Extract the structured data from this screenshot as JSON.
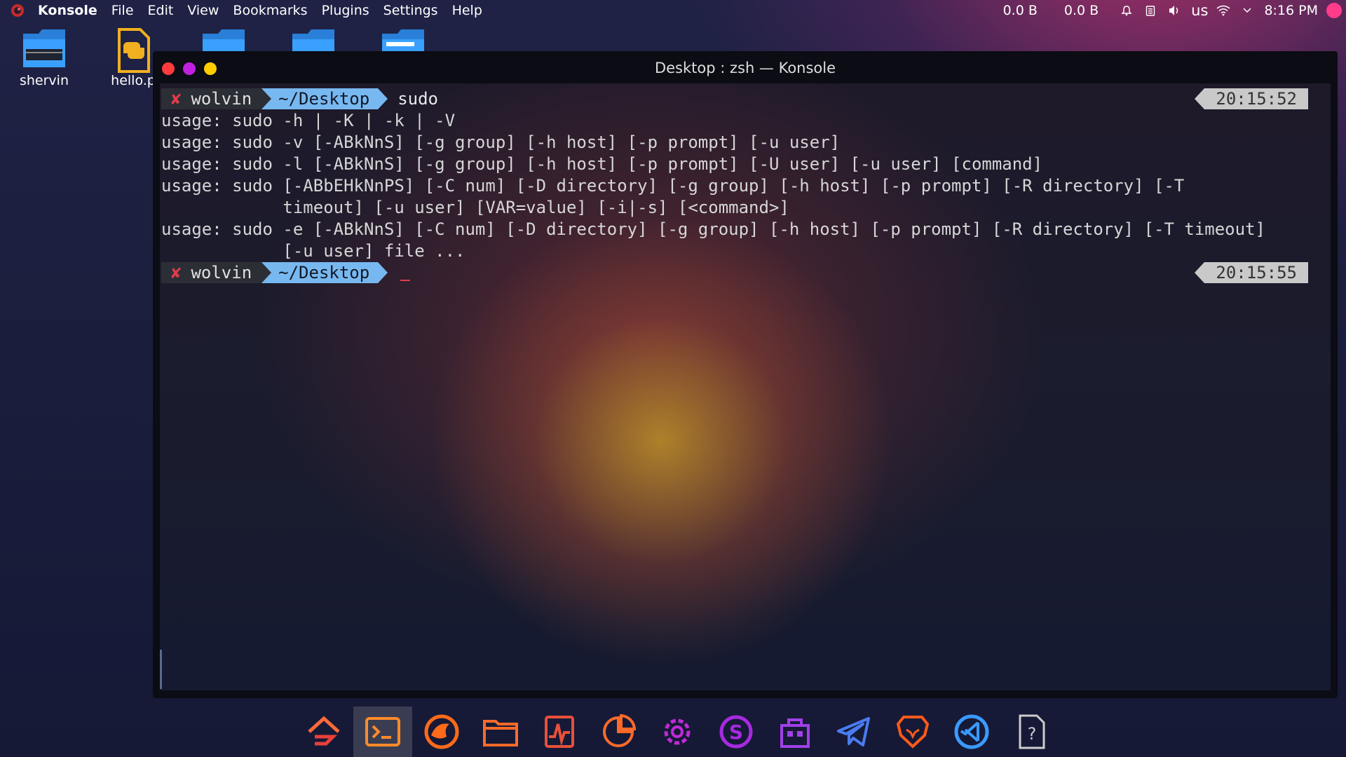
{
  "topbar": {
    "app_name": "Konsole",
    "menu": [
      "File",
      "Edit",
      "View",
      "Bookmarks",
      "Plugins",
      "Settings",
      "Help"
    ],
    "net_down": "0.0 B",
    "net_up": "0.0 B",
    "keyboard_layout": "us",
    "clock": "8:16 PM"
  },
  "desktop": {
    "icons": [
      {
        "label": "shervin"
      },
      {
        "label": "hello.p"
      }
    ]
  },
  "window": {
    "title": "Desktop : zsh — Konsole",
    "controls": {
      "close_color": "#ff3b3b",
      "minimize_color": "#c020e0",
      "maximize_color": "#ffcc00"
    }
  },
  "terminal": {
    "prompt1": {
      "user": "wolvin",
      "dir": "~/Desktop",
      "command": "sudo",
      "time": "20:15:52"
    },
    "output": [
      "usage: sudo -h | -K | -k | -V",
      "usage: sudo -v [-ABkNnS] [-g group] [-h host] [-p prompt] [-u user]",
      "usage: sudo -l [-ABkNnS] [-g group] [-h host] [-p prompt] [-U user] [-u user] [command]",
      "usage: sudo [-ABbEHkNnPS] [-C num] [-D directory] [-g group] [-h host] [-p prompt] [-R directory] [-T",
      "            timeout] [-u user] [VAR=value] [-i|-s] [<command>]",
      "usage: sudo -e [-ABkNnS] [-C num] [-D directory] [-g group] [-h host] [-p prompt] [-R directory] [-T timeout]",
      "            [-u user] file ..."
    ],
    "prompt2": {
      "user": "wolvin",
      "dir": "~/Desktop",
      "time": "20:15:55"
    }
  },
  "dock": {
    "items": [
      "git-app-icon",
      "terminal-icon",
      "browser-icon",
      "files-icon",
      "system-monitor-icon",
      "disk-usage-icon",
      "settings-icon",
      "skype-icon",
      "store-icon",
      "telegram-icon",
      "brave-icon",
      "vscode-icon",
      "help-icon"
    ],
    "active": "terminal-icon"
  }
}
